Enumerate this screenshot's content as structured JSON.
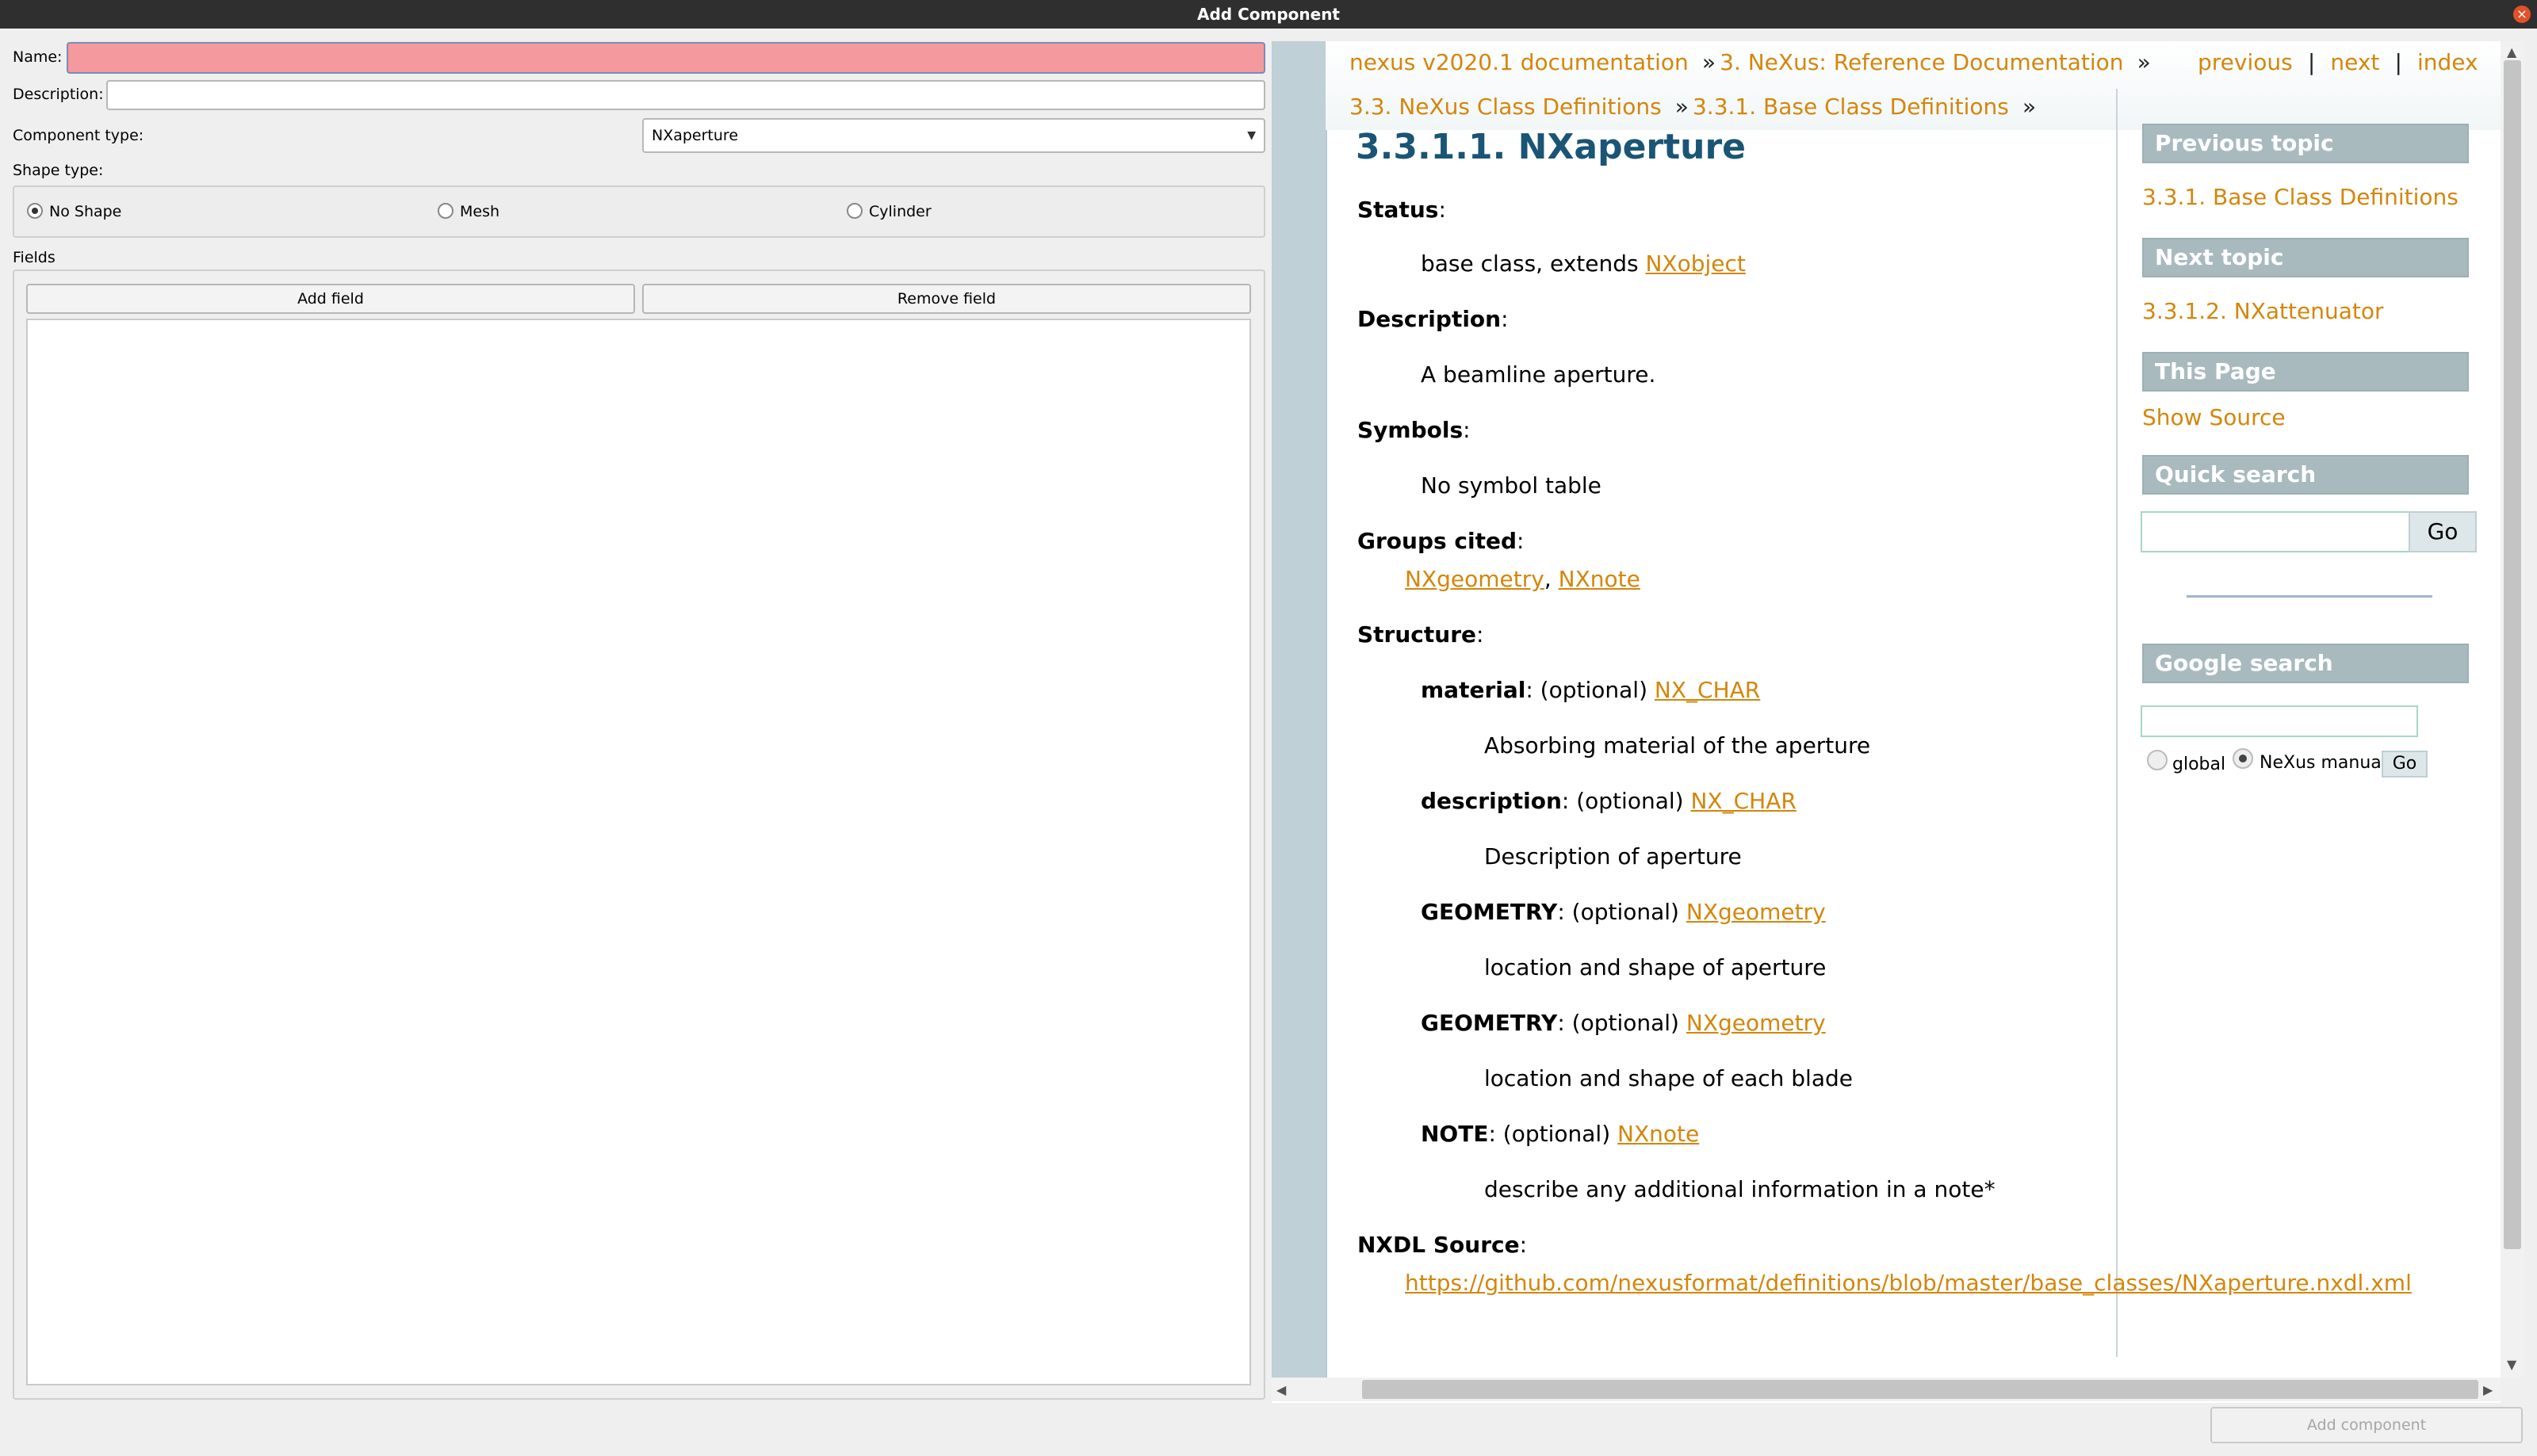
{
  "window": {
    "title": "Add Component"
  },
  "form": {
    "name_label": "Name:",
    "name_value": "",
    "description_label": "Description:",
    "description_value": "",
    "component_type_label": "Component type:",
    "component_type_value": "NXaperture",
    "shape_type_label": "Shape type:",
    "shape_options": [
      "No Shape",
      "Mesh",
      "Cylinder"
    ],
    "shape_selected": "No Shape",
    "fields_label": "Fields",
    "add_field": "Add field",
    "remove_field": "Remove field",
    "add_component": "Add component"
  },
  "doc": {
    "nav": {
      "crumb1": "nexus v2020.1 documentation",
      "crumb2": "3. NeXus: Reference Documentation",
      "crumb3": "3.3. NeXus Class Definitions",
      "crumb4": "3.3.1. Base Class Definitions",
      "raquo": "»",
      "previous": "previous",
      "next": "next",
      "index": "index",
      "pipe": "|"
    },
    "title": "3.3.1.1. NXaperture",
    "status_label": "Status",
    "status_text": "base class, extends",
    "status_link": "NXobject",
    "description_label": "Description",
    "description_text": "A beamline aperture.",
    "symbols_label": "Symbols",
    "symbols_text": "No symbol table",
    "groups_label": "Groups cited",
    "groups": [
      "NXgeometry",
      "NXnote"
    ],
    "structure_label": "Structure",
    "structure": [
      {
        "name": "material",
        "opt": ": (optional)",
        "type": "NX_CHAR",
        "doc": "Absorbing material of the aperture"
      },
      {
        "name": "description",
        "opt": ": (optional)",
        "type": "NX_CHAR",
        "doc": "Description of aperture"
      },
      {
        "name": "GEOMETRY",
        "opt": ": (optional)",
        "type": "NXgeometry",
        "doc": "location and shape of aperture"
      },
      {
        "name": "GEOMETRY",
        "opt": ": (optional)",
        "type": "NXgeometry",
        "doc": "location and shape of each blade"
      },
      {
        "name": "NOTE",
        "opt": ": (optional)",
        "type": "NXnote",
        "doc": "describe any additional information in a note*"
      }
    ],
    "nxdl_label": "NXDL Source",
    "nxdl_url": "https://github.com/nexusformat/definitions/blob/master/base_classes/NXaperture.nxdl.xml",
    "sidebar": {
      "prev_head": "Previous topic",
      "prev_link": "3.3.1. Base Class Definitions",
      "next_head": "Next topic",
      "next_link": "3.3.1.2. NXattenuator",
      "this_head": "This Page",
      "show_source": "Show Source",
      "quick_head": "Quick search",
      "go": "Go",
      "google_head": "Google search",
      "global": "global",
      "manual": "NeXus manual",
      "google_selected": "NeXus manual"
    }
  },
  "colors": {
    "link": "#d4860b",
    "title": "#1a5575",
    "sidebar_head": "#a9babf",
    "name_invalid": "#f4999d"
  }
}
